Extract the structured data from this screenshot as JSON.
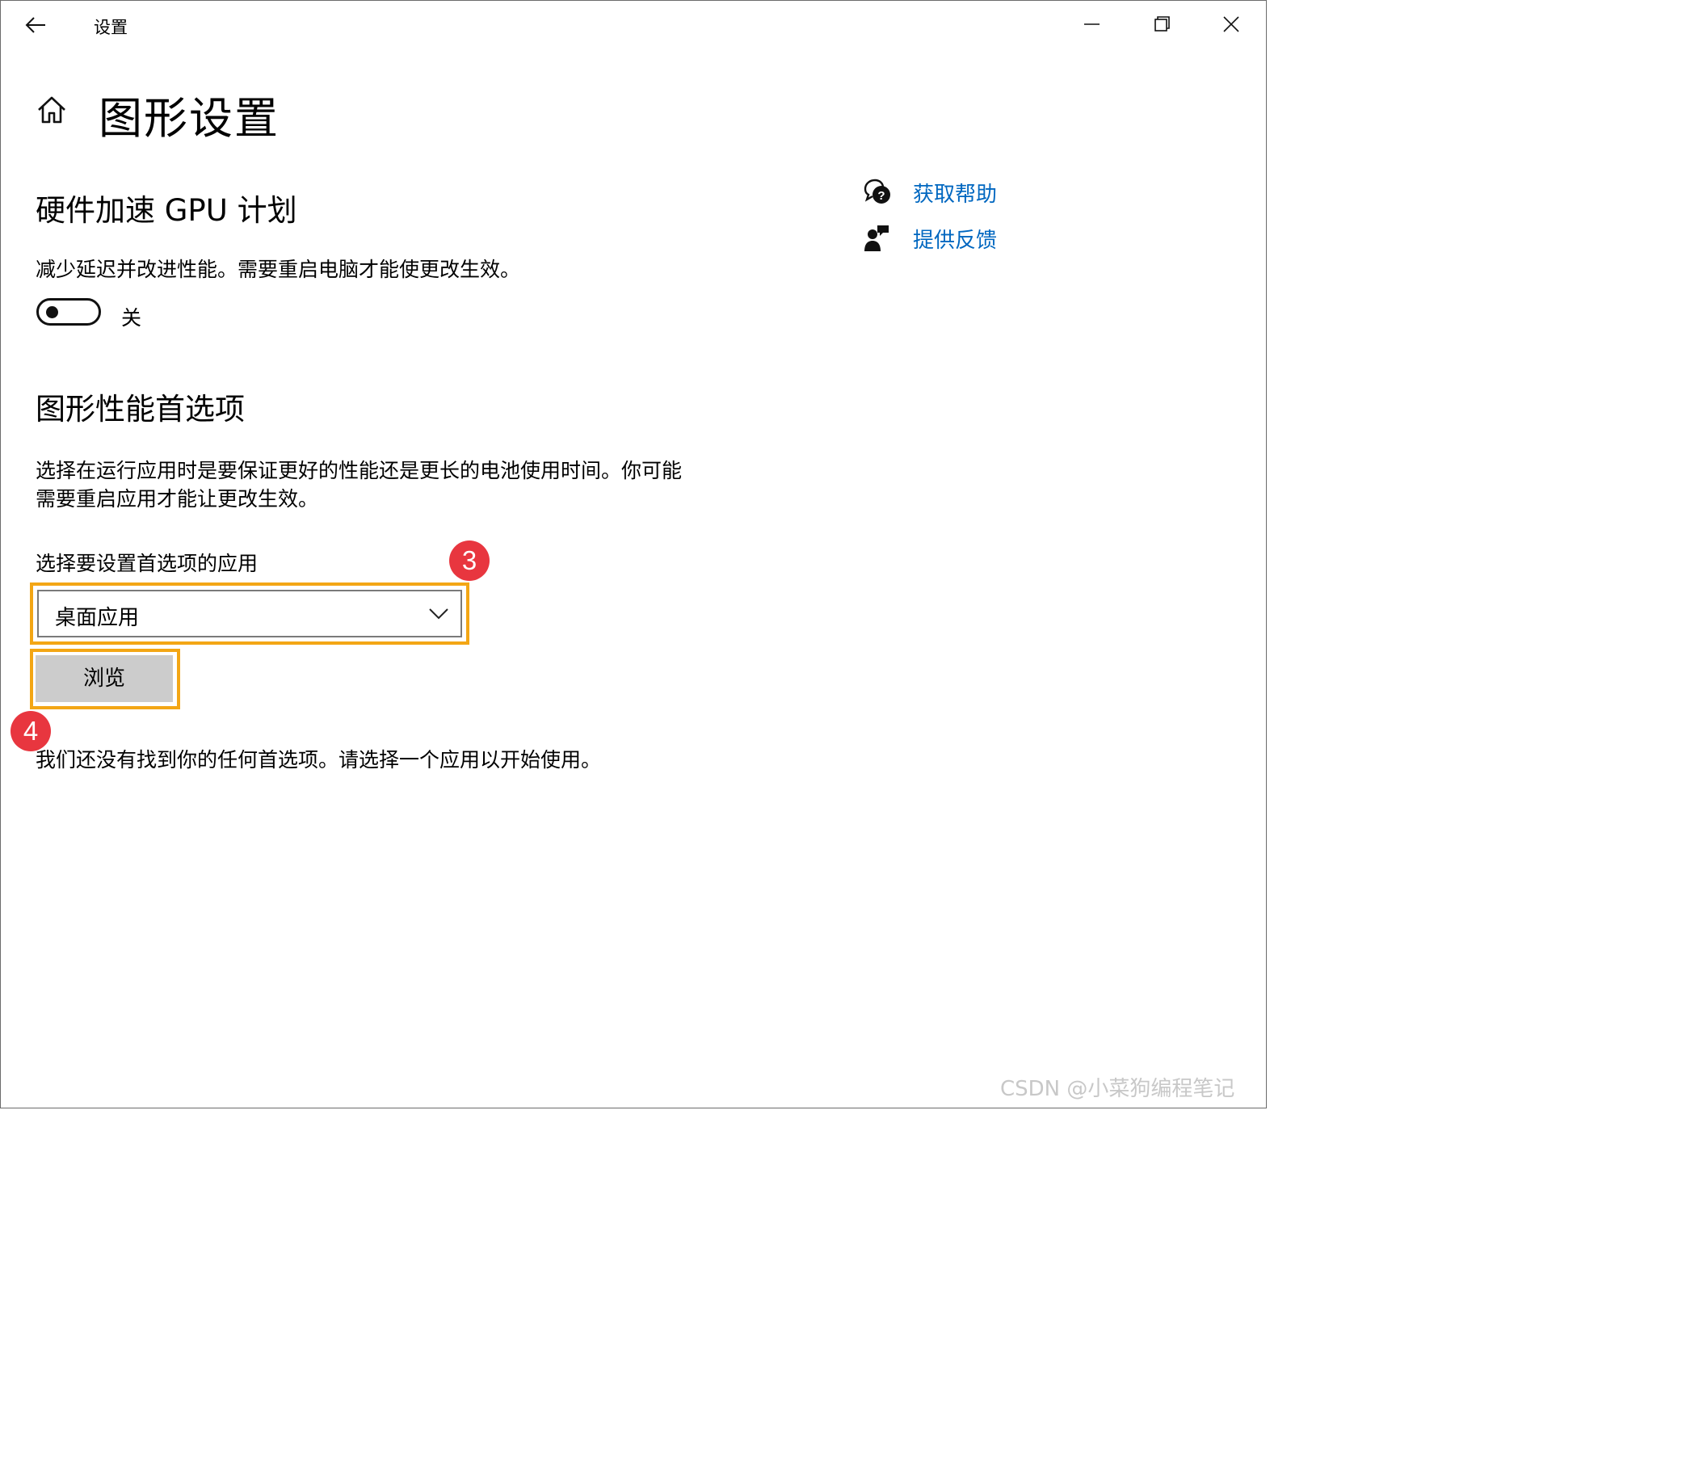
{
  "titlebar": {
    "title": "设置",
    "back_icon": "back-arrow-icon"
  },
  "window_controls": {
    "minimize": "minimize-icon",
    "maximize": "restore-icon",
    "close": "close-icon"
  },
  "header": {
    "home_icon": "home-icon",
    "title": "图形设置"
  },
  "gpu_section": {
    "heading": "硬件加速 GPU 计划",
    "description": "减少延迟并改进性能。需要重启电脑才能使更改生效。",
    "toggle_state_label": "关",
    "toggle_on": false
  },
  "pref_section": {
    "heading": "图形性能首选项",
    "description_line1": "选择在运行应用时是要保证更好的性能还是更长的电池使用时间。你可能",
    "description_line2": "需要重启应用才能让更改生效。",
    "select_label": "选择要设置首选项的应用",
    "select_value": "桌面应用",
    "browse_label": "浏览",
    "empty_text": "我们还没有找到你的任何首选项。请选择一个应用以开始使用。"
  },
  "annotations": {
    "badge_3": "3",
    "badge_4": "4",
    "highlight_color": "#f3a615",
    "badge_color": "#e8363f"
  },
  "help_links": {
    "get_help": "获取帮助",
    "feedback": "提供反馈",
    "get_help_icon": "help-chat-icon",
    "feedback_icon": "feedback-person-icon",
    "link_color": "#0067c0"
  },
  "watermark": "CSDN @小菜狗编程笔记"
}
